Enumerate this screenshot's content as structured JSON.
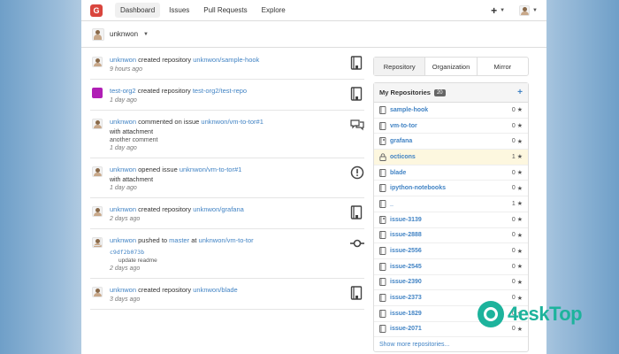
{
  "nav": {
    "items": [
      {
        "label": "Dashboard",
        "active": true
      },
      {
        "label": "Issues",
        "active": false
      },
      {
        "label": "Pull Requests",
        "active": false
      },
      {
        "label": "Explore",
        "active": false
      }
    ],
    "plus_label": "+",
    "logo_glyph": "G"
  },
  "context": {
    "user": "unknwon"
  },
  "feed": [
    {
      "actor": "unknwon",
      "verb": "created repository",
      "target": "unknwon/sample-hook",
      "time": "9 hours ago",
      "icon": "repo-icon",
      "avatar": "user"
    },
    {
      "actor": "test-org2",
      "verb": "created repository",
      "target": "test-org2/test-repo",
      "time": "1 day ago",
      "icon": "repo-icon",
      "avatar": "org"
    },
    {
      "actor": "unknwon",
      "verb": "commented on issue",
      "target": "unknwon/vm-to-tor#1",
      "sub": "with attachment",
      "sub2": "another comment",
      "time": "1 day ago",
      "icon": "comment-icon",
      "avatar": "user"
    },
    {
      "actor": "unknwon",
      "verb": "opened issue",
      "target": "unknwon/vm-to-tor#1",
      "sub": "with attachment",
      "time": "1 day ago",
      "icon": "issue-opened-icon",
      "avatar": "user"
    },
    {
      "actor": "unknwon",
      "verb": "created repository",
      "target": "unknwon/grafana",
      "time": "2 days ago",
      "icon": "repo-icon",
      "avatar": "user"
    },
    {
      "actor": "unknwon",
      "verb": "pushed to",
      "branch": "master",
      "at": "at",
      "target": "unknwon/vm-to-tor",
      "commit_sha": "c9df2b073b",
      "commit_msg": "update readme",
      "time": "2 days ago",
      "icon": "commit-icon",
      "avatar": "user"
    },
    {
      "actor": "unknwon",
      "verb": "created repository",
      "target": "unknwon/blade",
      "time": "3 days ago",
      "icon": "repo-icon",
      "avatar": "user"
    }
  ],
  "tabs": [
    {
      "label": "Repository",
      "active": true
    },
    {
      "label": "Organization",
      "active": false
    },
    {
      "label": "Mirror",
      "active": false
    }
  ],
  "repos": {
    "title": "My Repositories",
    "count": "20",
    "add_label": "+",
    "show_more": "Show more repositories...",
    "items": [
      {
        "name": "sample-hook",
        "stars": "0",
        "kind": "repo"
      },
      {
        "name": "vm-to-tor",
        "stars": "0",
        "kind": "repo"
      },
      {
        "name": "grafana",
        "stars": "0",
        "kind": "fork"
      },
      {
        "name": "octicons",
        "stars": "1",
        "kind": "private"
      },
      {
        "name": "blade",
        "stars": "0",
        "kind": "repo"
      },
      {
        "name": "ipython-notebooks",
        "stars": "0",
        "kind": "repo"
      },
      {
        "name": "_",
        "stars": "1",
        "kind": "repo"
      },
      {
        "name": "issue-3139",
        "stars": "0",
        "kind": "fork"
      },
      {
        "name": "issue-2888",
        "stars": "0",
        "kind": "repo"
      },
      {
        "name": "issue-2556",
        "stars": "0",
        "kind": "repo"
      },
      {
        "name": "issue-2545",
        "stars": "0",
        "kind": "repo"
      },
      {
        "name": "issue-2390",
        "stars": "0",
        "kind": "repo"
      },
      {
        "name": "issue-2373",
        "stars": "0",
        "kind": "repo"
      },
      {
        "name": "issue-1829",
        "stars": "0",
        "kind": "repo"
      },
      {
        "name": "issue-2071",
        "stars": "0",
        "kind": "repo"
      }
    ]
  },
  "watermark": {
    "text": "4eskTop"
  },
  "colors": {
    "brand": "#d9453d",
    "link": "#4183c4",
    "org_avatar": "#b01fb5",
    "private_row": "#fdf7df",
    "watermark": "#1db39c"
  }
}
